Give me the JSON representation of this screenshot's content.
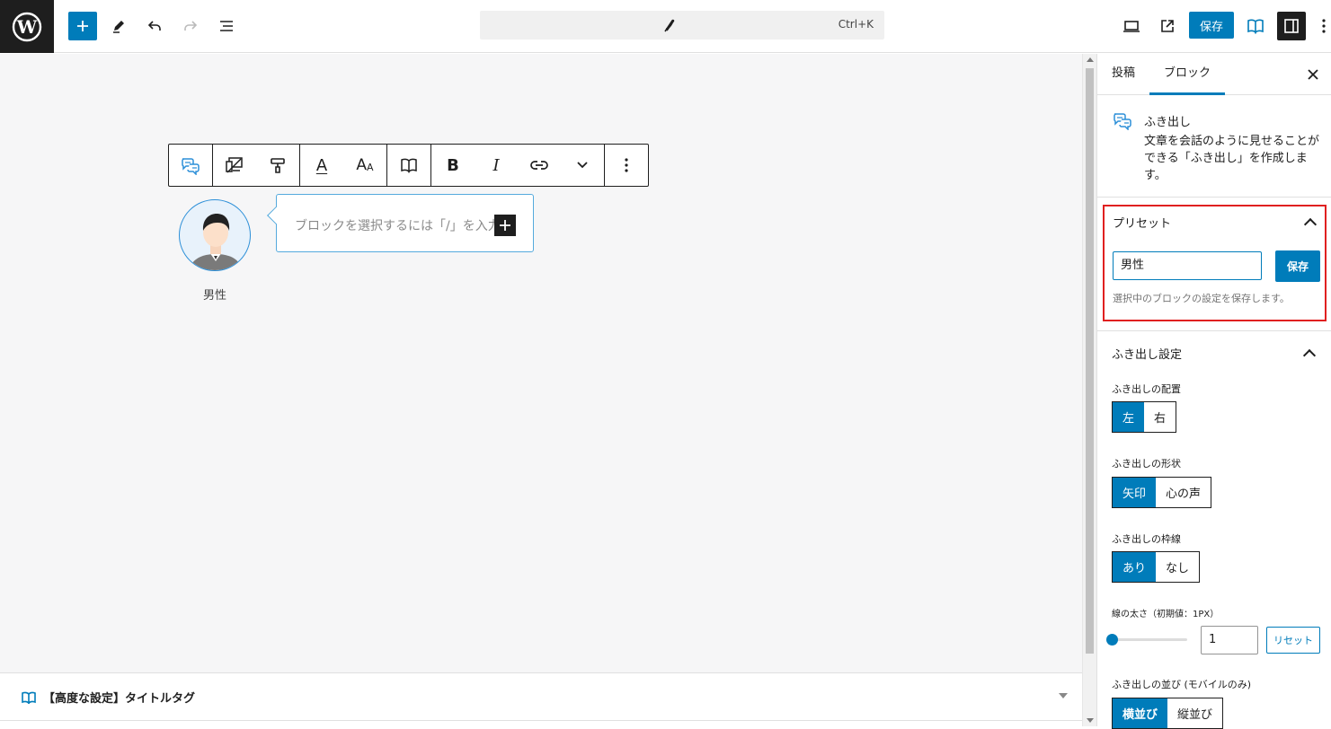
{
  "topbar": {
    "command_shortcut": "Ctrl+K",
    "save_label": "保存",
    "icons": [
      "wordpress-logo",
      "plus-icon",
      "pencil-icon",
      "undo-icon",
      "redo-icon",
      "list-view-icon",
      "feather-icon",
      "desktop-icon",
      "external-link-icon",
      "book-icon",
      "sidebar-icon",
      "more-vertical-icon"
    ]
  },
  "canvas": {
    "toolbar_letter_a": "A",
    "toolbar_letter_aa_big": "A",
    "toolbar_letter_aa_small": "A",
    "toolbar_bold": "B",
    "toolbar_italic": "I",
    "avatar_name": "男性",
    "bubble_placeholder": "ブロックを選択するには「/」を入力"
  },
  "metabox": {
    "title": "【高度な設定】タイトルタグ"
  },
  "sidebar": {
    "tab_post": "投稿",
    "tab_block": "ブロック",
    "block_name": "ふき出し",
    "block_description": "文章を会話のように見せることができる「ふき出し」を作成します。",
    "preset": {
      "title": "プリセット",
      "input_value": "男性",
      "save_label": "保存",
      "help": "選択中のブロックの設定を保存します。"
    },
    "settings": {
      "title": "ふき出し設定",
      "placement_label": "ふき出しの配置",
      "placement_left": "左",
      "placement_right": "右",
      "shape_label": "ふき出しの形状",
      "shape_arrow": "矢印",
      "shape_thought": "心の声",
      "border_label": "ふき出しの枠線",
      "border_yes": "あり",
      "border_no": "なし",
      "width_label": "線の太さ（初期値：1PX）",
      "width_value": "1",
      "reset_label": "リセット",
      "order_label": "ふき出しの並び (モバイルのみ)",
      "order_horizontal": "横並び",
      "order_vertical": "縦並び"
    }
  },
  "colors": {
    "accent": "#007cba",
    "highlight_border": "#e02020",
    "dark": "#1e1e1e"
  }
}
